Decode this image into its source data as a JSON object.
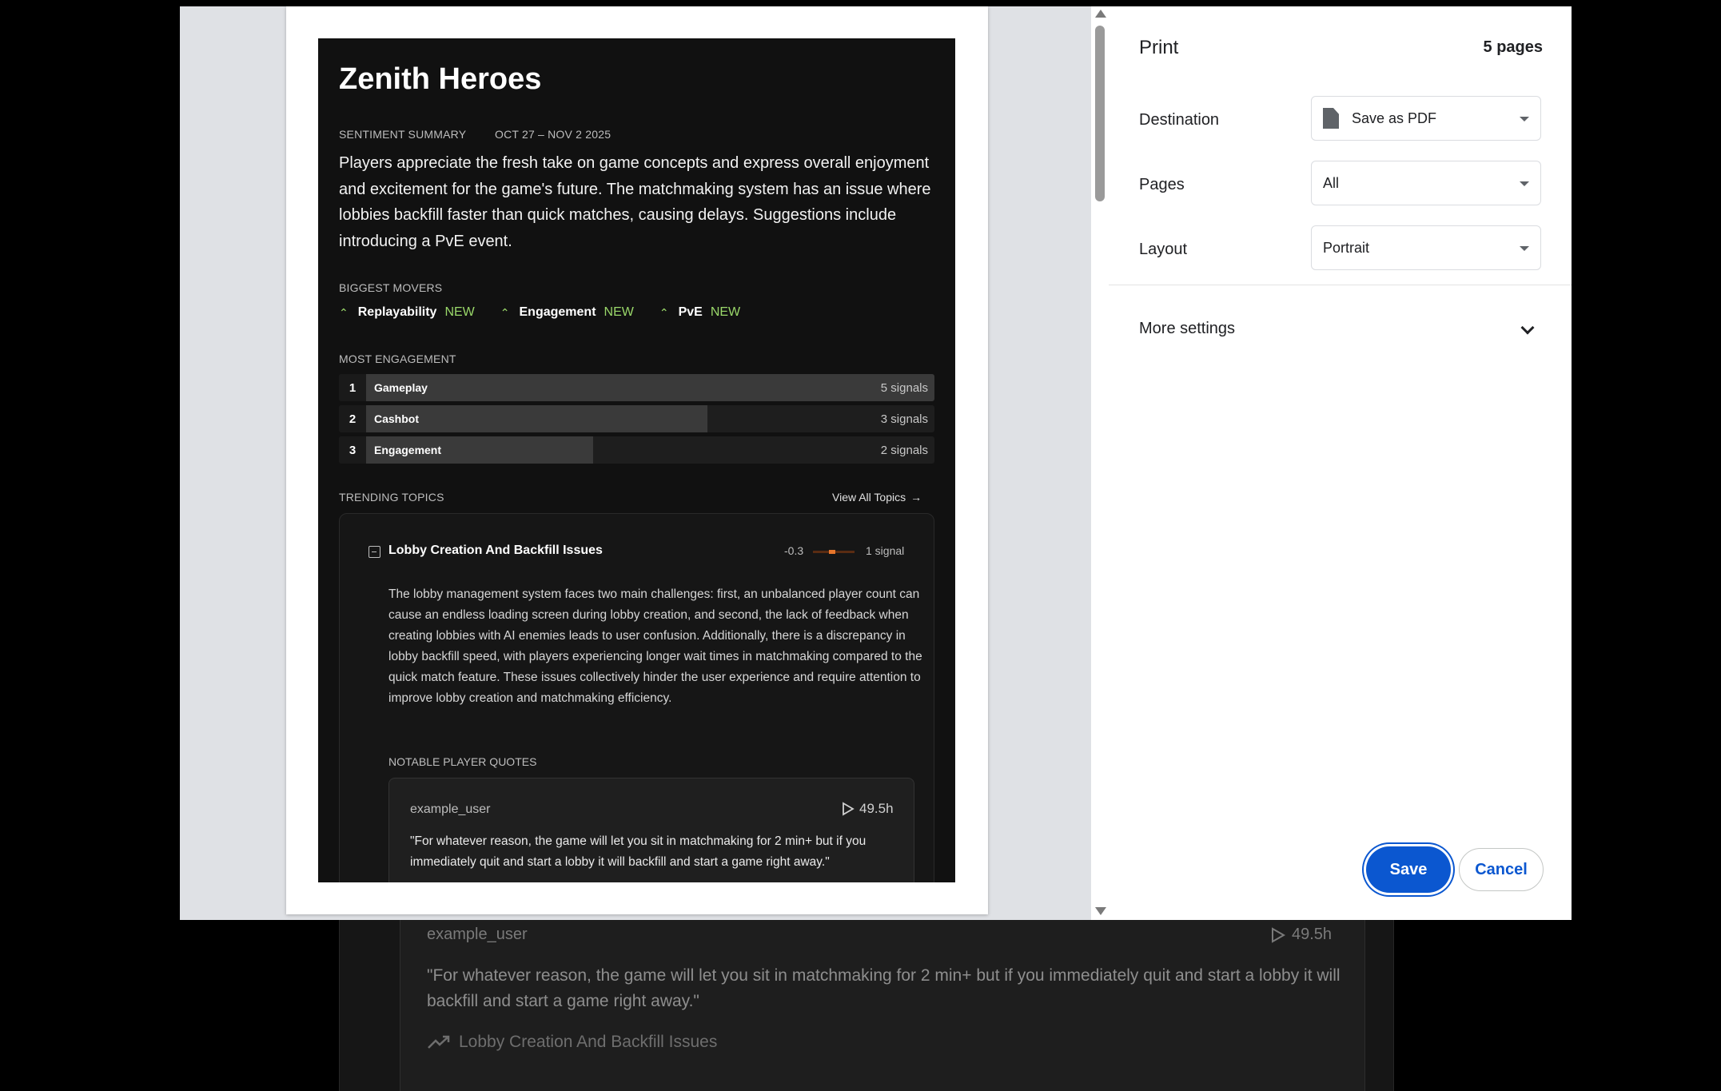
{
  "background": {
    "quote_user": "example_user",
    "quote_time": "49.5h",
    "quote_text": "\"For whatever reason, the game will let you sit in matchmaking for 2 min+ but if you immediately quit and start a lobby it will backfill and start a game right away.\"",
    "topic_link": "Lobby Creation And Backfill Issues"
  },
  "print_dialog": {
    "title": "Print",
    "page_count": "5 pages",
    "destination_label": "Destination",
    "destination_value": "Save as PDF",
    "pages_label": "Pages",
    "pages_value": "All",
    "layout_label": "Layout",
    "layout_value": "Portrait",
    "more_settings": "More settings",
    "save_label": "Save",
    "cancel_label": "Cancel"
  },
  "document": {
    "title": "Zenith Heroes",
    "summary_label": "SENTIMENT SUMMARY",
    "date_range": "OCT 27 – NOV 2 2025",
    "summary": "Players appreciate the fresh take on game concepts and express overall enjoyment and excitement for the game's future. The matchmaking system has an issue where lobbies backfill faster than quick matches, causing delays. Suggestions include introducing a PvE event.",
    "movers_label": "BIGGEST MOVERS",
    "movers": [
      {
        "name": "Replayability",
        "badge": "NEW"
      },
      {
        "name": "Engagement",
        "badge": "NEW"
      },
      {
        "name": "PvE",
        "badge": "NEW"
      }
    ],
    "engagement_label": "MOST ENGAGEMENT",
    "engagement": [
      {
        "rank": "1",
        "name": "Gameplay",
        "count": "5 signals",
        "share": 1.0
      },
      {
        "rank": "2",
        "name": "Cashbot",
        "count": "3 signals",
        "share": 0.6
      },
      {
        "rank": "3",
        "name": "Engagement",
        "count": "2 signals",
        "share": 0.4
      }
    ],
    "trending_label": "TRENDING TOPICS",
    "view_all": "View All Topics",
    "topic": {
      "title": "Lobby Creation And Backfill Issues",
      "score": "-0.3",
      "signals": "1 signal",
      "body": "The lobby management system faces two main challenges: first, an unbalanced player count can cause an endless loading screen during lobby creation, and second, the lack of feedback when creating lobbies with AI enemies leads to user confusion. Additionally, there is a discrepancy in lobby backfill speed, with players experiencing longer wait times in matchmaking compared to the quick match feature. These issues collectively hinder the user experience and require attention to improve lobby creation and matchmaking efficiency.",
      "quotes_label": "NOTABLE PLAYER QUOTES",
      "quote_user": "example_user",
      "quote_time": "49.5h",
      "quote_text": "\"For whatever reason, the game will let you sit in matchmaking for 2 min+ but if you immediately quit and start a lobby it will backfill and start a game right away.\""
    }
  }
}
